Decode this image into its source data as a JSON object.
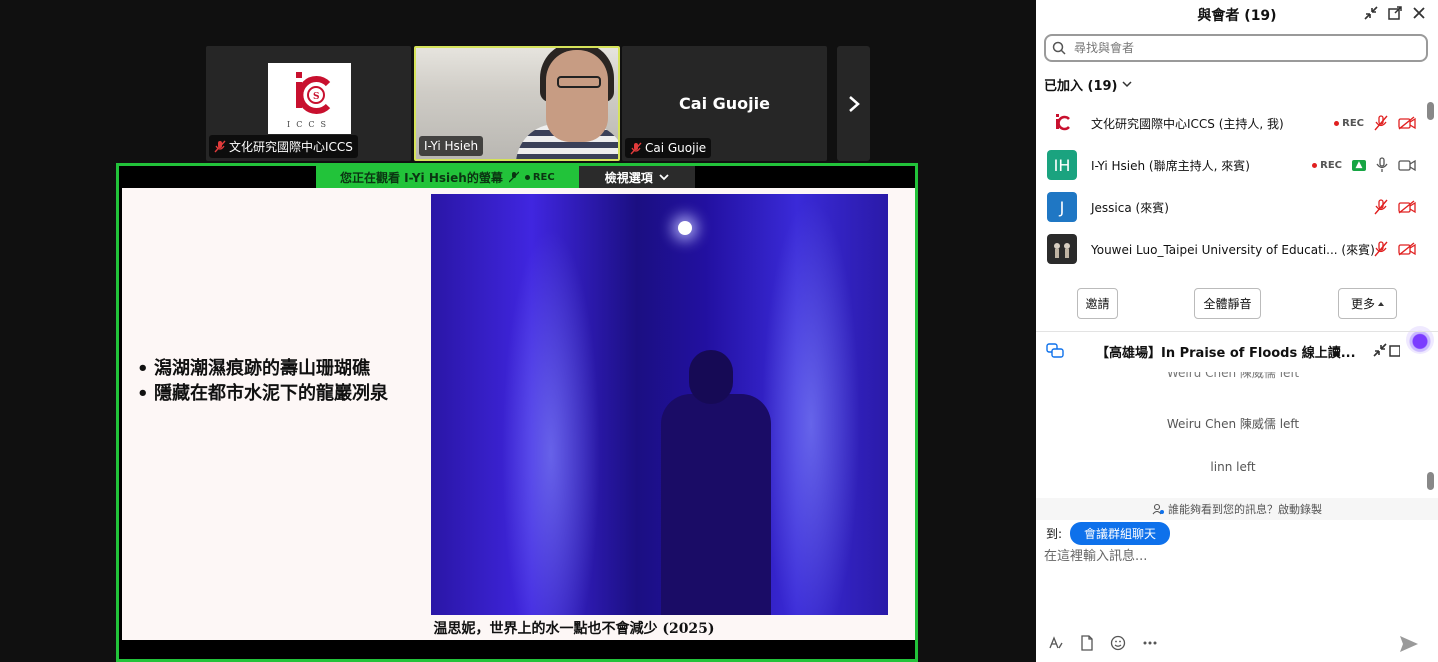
{
  "tiles": [
    {
      "label": "文化研究國際中心ICCS",
      "logo_text": "ICCS"
    },
    {
      "label": "I-Yi Hsieh"
    },
    {
      "label": "Cai Guojie",
      "center_name": "Cai Guojie"
    }
  ],
  "share": {
    "status": "您正在觀看 I-Yi Hsieh的螢幕",
    "rec": "REC",
    "view_options": "檢視選項"
  },
  "slide": {
    "bullets": [
      "潟湖潮濕痕跡的壽山珊瑚礁",
      "隱藏在都市水泥下的龍巖冽泉"
    ],
    "caption": "温思妮，世界上的水一點也不會減少 (2025)"
  },
  "participants_panel": {
    "title": "與會者 (19)",
    "search_placeholder": "尋找與會者",
    "joined_label": "已加入 (19)",
    "participants": [
      {
        "name": "文化研究國際中心ICCS (主持人, 我)",
        "rec": "REC"
      },
      {
        "name": "I-Yi Hsieh (聯席主持人, 來賓)",
        "initials": "IH",
        "rec": "REC"
      },
      {
        "name": "Jessica (來賓)",
        "initials": "J"
      },
      {
        "name": "Youwei Luo_Taipei University of Educati...  (來賓)"
      }
    ],
    "buttons": {
      "invite": "邀請",
      "mute_all": "全體靜音",
      "more": "更多"
    }
  },
  "chat": {
    "title": "【高雄場】In Praise of Floods 線上讀...",
    "clipped_message": "Weiru Chen 陳威儒 left",
    "messages": [
      "Weiru Chen 陳威儒 left",
      "linn left"
    ],
    "privacy_note": "誰能夠看到您的訊息？啟動錄製",
    "to_label": "到:",
    "to_target": "會議群組聊天",
    "input_placeholder": "在這裡輸入訊息..."
  },
  "colors": {
    "active_speaker": "#d6e35a",
    "share_border": "#22c33a",
    "accent_blue": "#0e71eb",
    "rec_red": "#e02020",
    "avatar_ih": "#1aa37f",
    "avatar_j": "#1f77c4"
  }
}
